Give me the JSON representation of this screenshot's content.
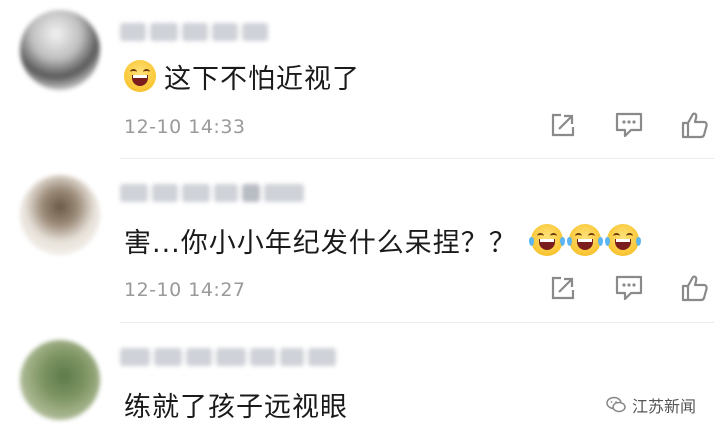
{
  "comments": [
    {
      "text": "这下不怕近视了",
      "time": "12-10 14:33",
      "emoji_before": [
        "laugh-emoji"
      ],
      "emoji_after": []
    },
    {
      "text": "害...你小小年纪发什么呆捏？？",
      "time": "12-10 14:27",
      "emoji_before": [],
      "emoji_after": [
        "tears-of-joy-emoji",
        "tears-of-joy-emoji",
        "tears-of-joy-emoji"
      ]
    },
    {
      "text": "练就了孩子远视眼",
      "time": "",
      "emoji_before": [],
      "emoji_after": []
    }
  ],
  "actions": {
    "share_icon": "share-icon",
    "reply_icon": "reply-icon",
    "like_icon": "thumbs-up-icon"
  },
  "watermark": {
    "label": "江苏新闻"
  },
  "colors": {
    "text": "#1a1a1a",
    "muted": "#9a9a9a",
    "divider": "#ececec",
    "icon": "#8a8a8a"
  }
}
